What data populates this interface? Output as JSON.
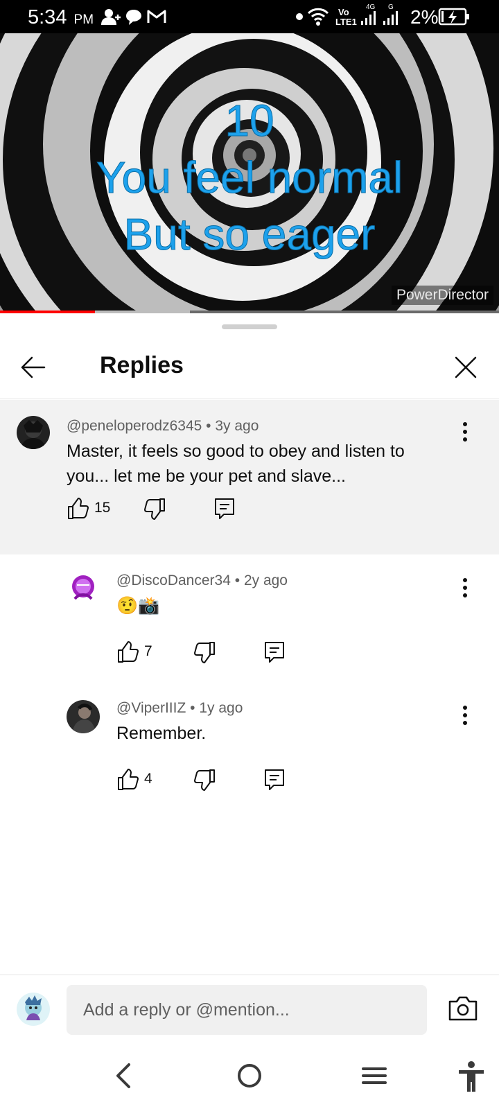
{
  "status_bar": {
    "time": "5:34",
    "ampm": "PM",
    "network_label_top": "Vo",
    "network_label_bottom": "LTE1",
    "sim1_label": "4G",
    "sim2_label": "G",
    "battery": "2%"
  },
  "video": {
    "overlay_lines": [
      "10",
      "You feel normal",
      "But so eager"
    ],
    "watermark": "PowerDirector",
    "progress_fraction": 0.19,
    "buffer_fraction": 0.38,
    "overlay_color": "#1da1ec"
  },
  "header": {
    "title": "Replies",
    "back_icon": "arrow-left-icon",
    "close_icon": "close-icon"
  },
  "comments": [
    {
      "author": "@peneloperodz6345",
      "separator": "•",
      "age": "3y ago",
      "text": "Master, it feels so good to obey and listen to you... let me be your pet and slave...",
      "likes": "15",
      "pinned_background": "#f2f2f2"
    },
    {
      "author": "@DiscoDancer34",
      "separator": "•",
      "age": "2y ago",
      "text": "🤨📸",
      "likes": "7"
    },
    {
      "author": "@ViperIIIZ",
      "separator": "•",
      "age": "1y ago",
      "text": "Remember.",
      "likes": "4"
    }
  ],
  "reply_bar": {
    "placeholder": "Add a reply or @mention...",
    "camera_icon": "camera-icon"
  },
  "nav_bar": {
    "icons": [
      "back-chevron-icon",
      "home-circle-icon",
      "menu-lines-icon",
      "accessibility-icon"
    ]
  },
  "colors": {
    "accent": "#ff0000",
    "text_primary": "#0f0f0f",
    "text_secondary": "#606060"
  }
}
